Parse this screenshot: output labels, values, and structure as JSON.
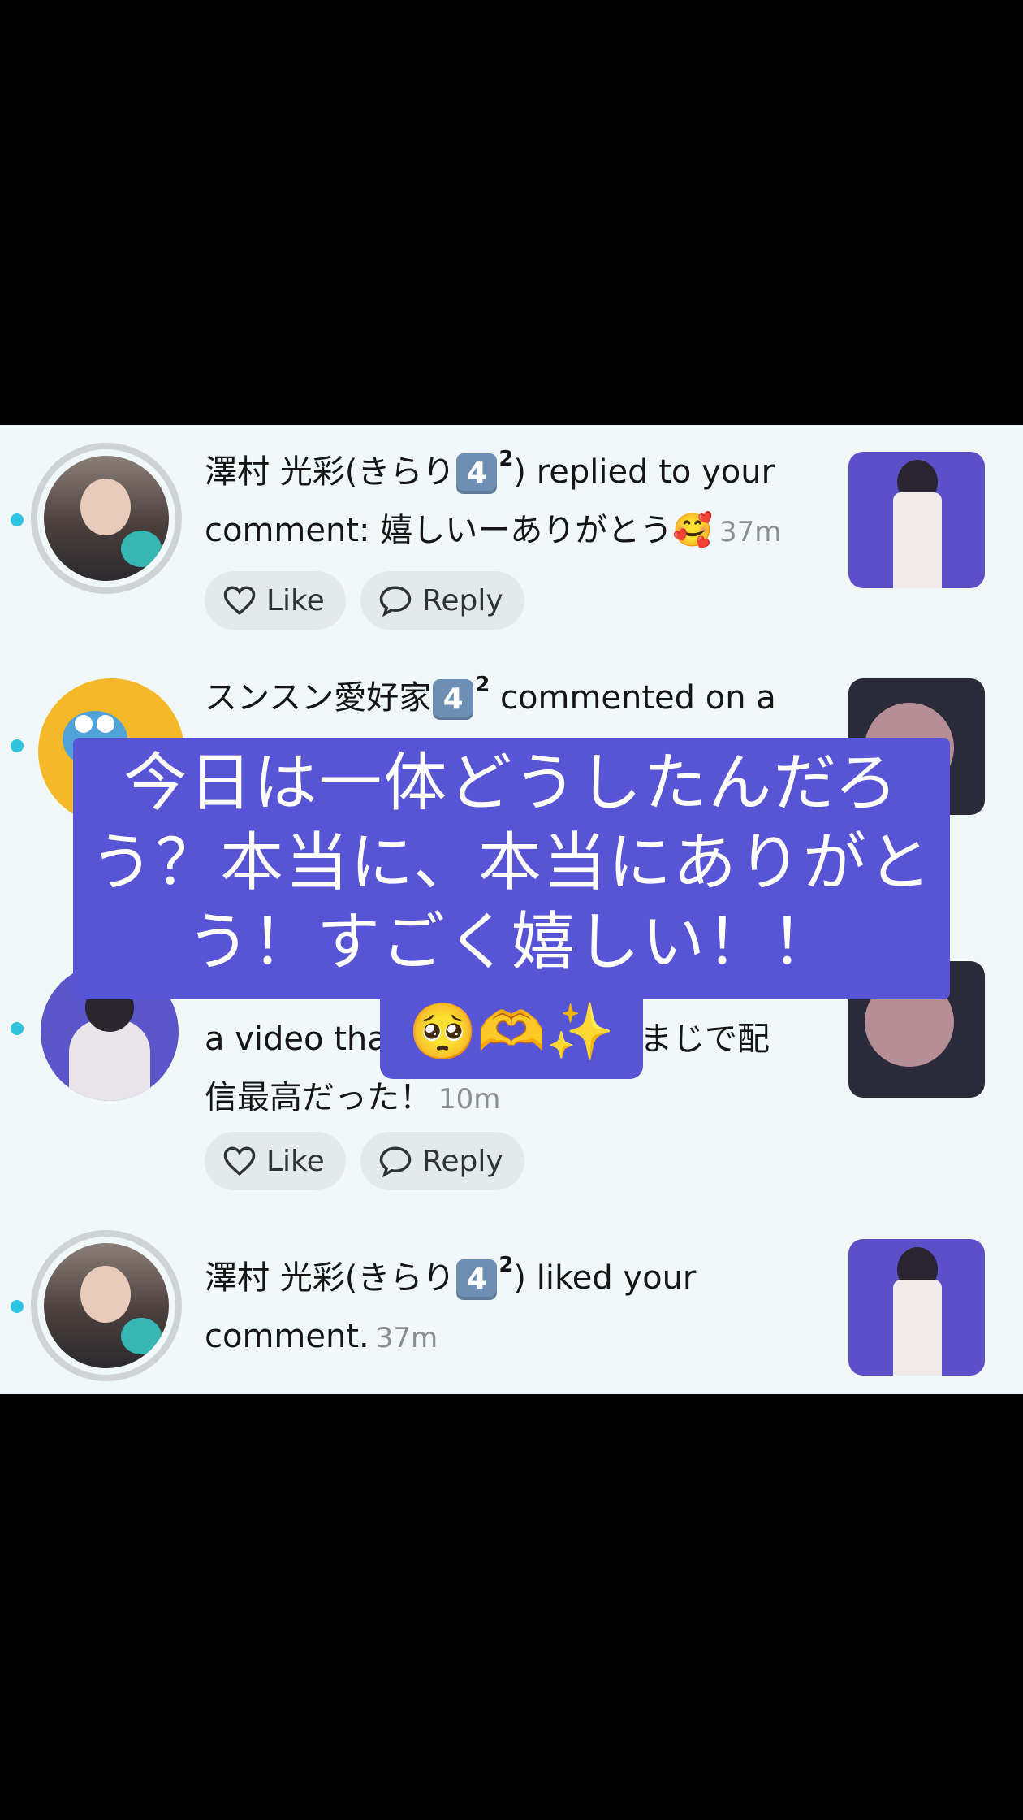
{
  "notifications": [
    {
      "user": "澤村 光彩(きらり",
      "badge": "4",
      "badge_sup": "2",
      "suffix": ") replied to your",
      "line2": "comment: 嬉しいーありがとう🥰",
      "time": "37m",
      "like_label": "Like",
      "reply_label": "Reply"
    },
    {
      "user": "スンスン愛好家",
      "badge": "4",
      "badge_sup": "2",
      "suffix": " commented on a"
    },
    {
      "line1": "a video tha",
      "line1_tail": ": まじで配",
      "line2": "信最高だった！",
      "time": "10m",
      "like_label": "Like",
      "reply_label": "Reply"
    },
    {
      "user": "澤村 光彩(きらり",
      "badge": "4",
      "badge_sup": "2",
      "suffix": ") liked your",
      "line2": "comment.",
      "time": "37m"
    }
  ],
  "overlay": {
    "caption": "今日は一体どうしたんだろう？本当に、本当にありがとう！すごく嬉しい！！",
    "emoji": "🥺🫶✨"
  },
  "colors": {
    "background": "#f1f8f9",
    "unread_dot": "#2ec3df",
    "overlay": "#5754d6",
    "badge": "#6d8fb4"
  }
}
